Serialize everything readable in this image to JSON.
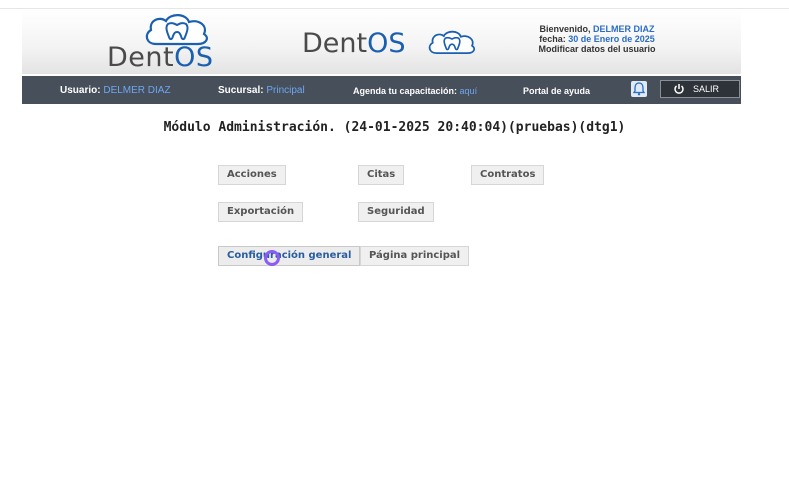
{
  "header": {
    "logo_left": {
      "part1": "Dent",
      "part2": "OS"
    },
    "logo_right": {
      "part1": "Dent",
      "part2": "OS"
    },
    "welcome": {
      "line1_prefix": "Bienvenido, ",
      "user_name": "DELMER DIAZ",
      "line2_prefix": "fecha: ",
      "date": "30 de Enero de 2025",
      "line3": "Modificar datos del usuario"
    }
  },
  "navbar": {
    "usuario_label": "Usuario:",
    "usuario_value": "DELMER DIAZ",
    "sucursal_label": "Sucursal:",
    "sucursal_value": "Principal",
    "agenda_label": "Agenda tu capacitación:",
    "agenda_link": "aquí",
    "portal": "Portal de ayuda",
    "salir": "SALIR",
    "icons": [
      "bell-icon",
      "power-icon"
    ]
  },
  "module_title": "Módulo Administración. (24-01-2025 20:40:04)(pruebas)(dtg1)",
  "buttons": {
    "acciones": "Acciones",
    "citas": "Citas",
    "contratos": "Contratos",
    "exportacion": "Exportación",
    "seguridad": "Seguridad",
    "configuracion": "Configuración general",
    "pagina_principal": "Página principal"
  },
  "colors": {
    "navbar_bg": "#474f5b",
    "accent_blue": "#1a5fb0",
    "link_blue": "#6ea7ef",
    "cursor": "#8b5cf6"
  }
}
